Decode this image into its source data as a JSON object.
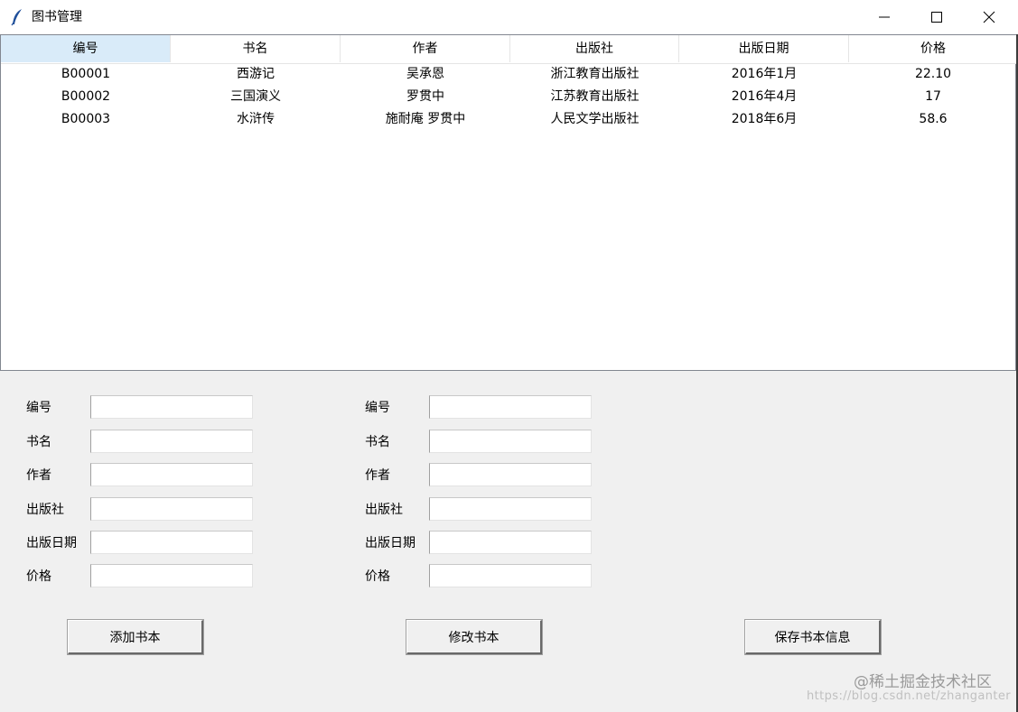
{
  "window": {
    "title": "图书管理",
    "icon": "feather-icon",
    "controls": [
      "minimize-icon",
      "maximize-icon",
      "close-icon"
    ]
  },
  "table": {
    "columns": [
      "编号",
      "书名",
      "作者",
      "出版社",
      "出版日期",
      "价格"
    ],
    "rows": [
      [
        "B00001",
        "西游记",
        "吴承恩",
        "浙江教育出版社",
        "2016年1月",
        "22.10"
      ],
      [
        "B00002",
        "三国演义",
        "罗贯中",
        "江苏教育出版社",
        "2016年4月",
        "17"
      ],
      [
        "B00003",
        "水浒传",
        "施耐庵 罗贯中",
        "人民文学出版社",
        "2018年6月",
        "58.6"
      ]
    ]
  },
  "add_form": {
    "labels": [
      "编号",
      "书名",
      "作者",
      "出版社",
      "出版日期",
      "价格"
    ],
    "values": [
      "",
      "",
      "",
      "",
      "",
      ""
    ]
  },
  "edit_form": {
    "labels": [
      "编号",
      "书名",
      "作者",
      "出版社",
      "出版日期",
      "价格"
    ],
    "values": [
      "",
      "",
      "",
      "",
      "",
      ""
    ]
  },
  "buttons": {
    "add": "添加书本",
    "modify": "修改书本",
    "save": "保存书本信息"
  },
  "watermark": {
    "line1": "@稀土掘金技术社区",
    "line2": "https://blog.csdn.net/zhanganter"
  },
  "colors": {
    "header_active": "#d9ebf9",
    "window_bg": "#f0f0f0"
  }
}
